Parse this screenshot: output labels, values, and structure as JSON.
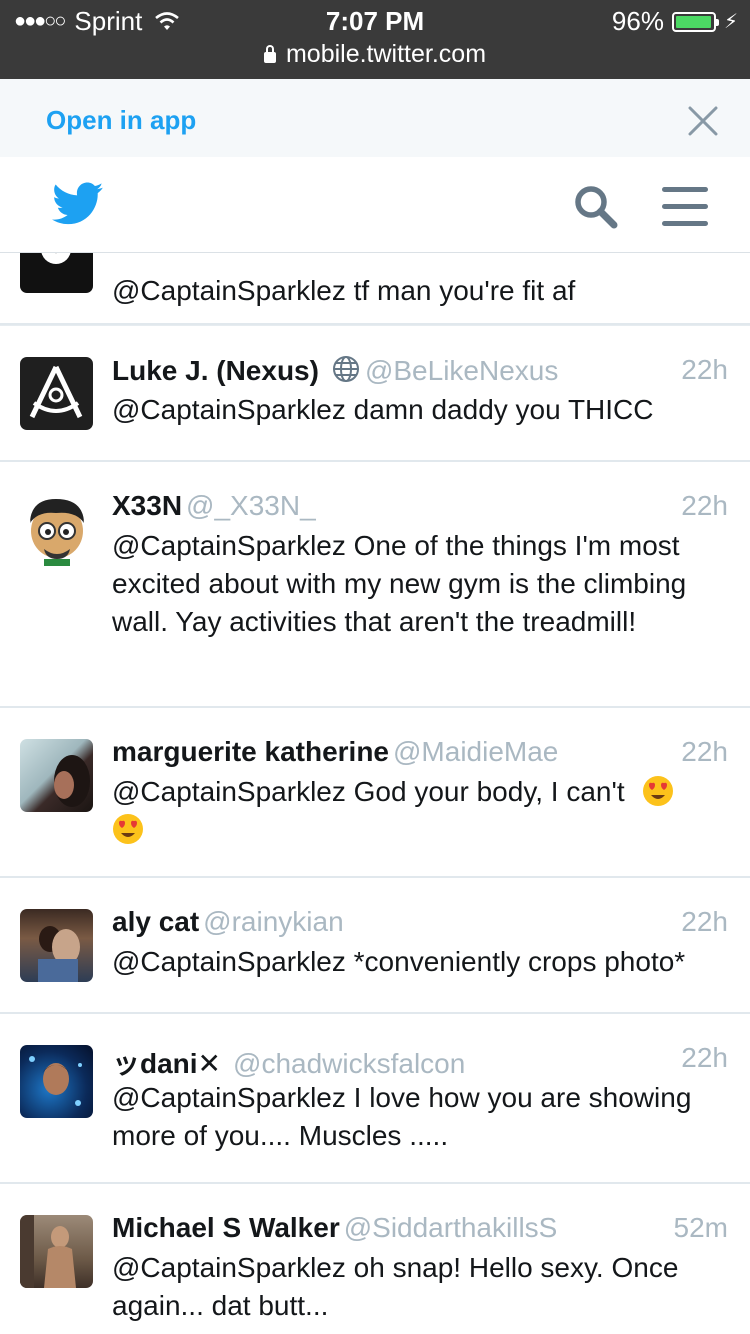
{
  "status_bar": {
    "signal": "●●●○○",
    "carrier": "Sprint",
    "time": "7:07 PM",
    "url": "mobile.twitter.com",
    "battery": "96%",
    "battery_level": 0.96
  },
  "open_bar": {
    "link": "Open in app"
  },
  "nav": {
    "logo_icon": "twitter-bird-icon",
    "search_icon": "search-icon",
    "menu_icon": "hamburger-menu-icon"
  },
  "tweets": [
    {
      "name": "",
      "handle": "",
      "time": "",
      "text": "@CaptainSparklez tf man you're fit af"
    },
    {
      "name": "Luke J. (Nexus)",
      "handle": "@BeLikeNexus",
      "time": "22h",
      "text": "@CaptainSparklez damn daddy you THICC"
    },
    {
      "name": "X33N",
      "handle": "@_X33N_",
      "time": "22h",
      "text": "@CaptainSparklez One of the things I'm most excited about with my new gym is the climbing wall.  Yay activities that aren't the treadmill!"
    },
    {
      "name": "marguerite katherine",
      "handle": "@MaidieMae",
      "time": "22h",
      "text": "@CaptainSparklez God your body, I can't"
    },
    {
      "name": "aly cat",
      "handle": "@rainykian",
      "time": "22h",
      "text": "@CaptainSparklez *conveniently crops photo*"
    },
    {
      "name": "ッdani✕",
      "handle": "@chadwicksfalcon",
      "time": "22h",
      "text": "@CaptainSparklez I love how you are showing more of you.... Muscles ....."
    },
    {
      "name": "Michael S Walker",
      "handle": "@SiddarthakillsS",
      "time": "52m",
      "text": "@CaptainSparklez oh snap! Hello sexy. Once again... dat butt..."
    }
  ],
  "colors": {
    "accent": "#1da1f2",
    "secondary_text": "#aab8c2",
    "status_bar_bg": "#3a3a3a"
  }
}
